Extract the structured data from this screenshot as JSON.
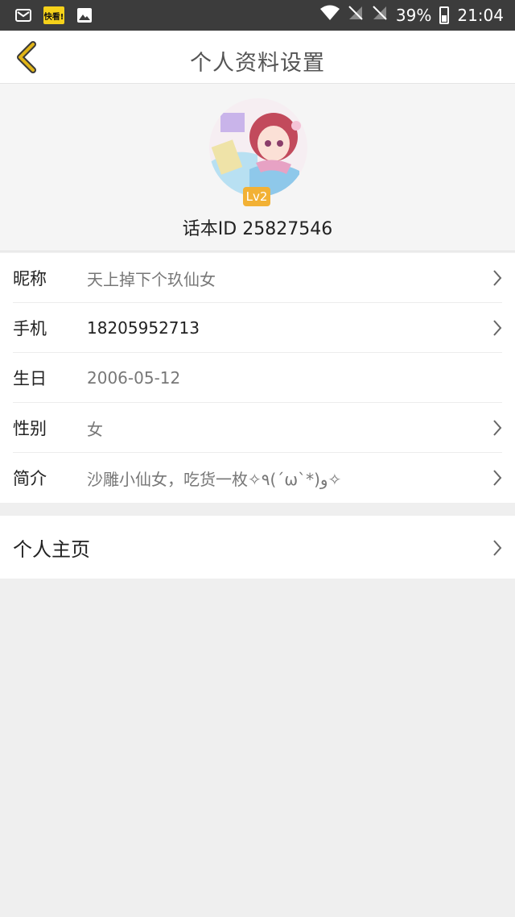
{
  "status_bar": {
    "left_icons": [
      "mail-icon",
      "kuaikan-app-icon",
      "image-icon"
    ],
    "kuaikan_label": "快看!",
    "battery": "39%",
    "time": "21:04"
  },
  "navbar": {
    "title": "个人资料设置"
  },
  "profile": {
    "level": "Lv2",
    "id_text": "话本ID 25827546"
  },
  "fields": [
    {
      "label": "昵称",
      "value": "天上掉下个玖仙女",
      "has_arrow": true
    },
    {
      "label": "手机",
      "value": "18205952713",
      "has_arrow": true
    },
    {
      "label": "生日",
      "value": "2006-05-12",
      "has_arrow": false
    },
    {
      "label": "性别",
      "value": "女",
      "has_arrow": true
    },
    {
      "label": "简介",
      "value": "沙雕小仙女，吃货一枚✧٩(ˊωˋ*)و✧",
      "has_arrow": true
    }
  ],
  "homepage": {
    "label": "个人主页"
  },
  "colors": {
    "accent": "#f2b135",
    "back_arrow": "#e0b418"
  }
}
